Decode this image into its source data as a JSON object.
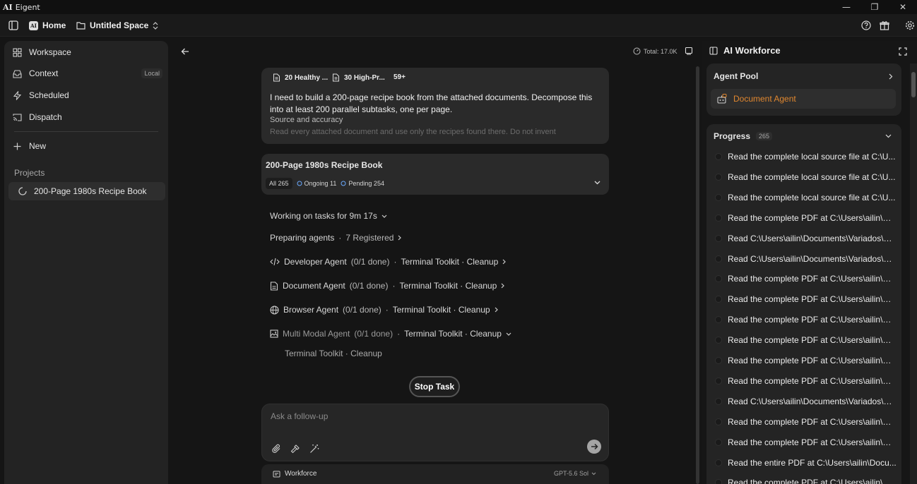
{
  "window": {
    "logo": "AI",
    "title": "Eigent",
    "minimize": "—",
    "restore": "❐",
    "close": "✕"
  },
  "topbar": {
    "home_label": "Home",
    "space_label": "Untitled Space",
    "logo_text": "AI"
  },
  "sidebar": {
    "items": [
      {
        "label": "Workspace",
        "icon": "grid-icon"
      },
      {
        "label": "Context",
        "icon": "inbox-icon",
        "badge": "Local"
      },
      {
        "label": "Scheduled",
        "icon": "bolt-icon"
      },
      {
        "label": "Dispatch",
        "icon": "cast-icon"
      }
    ],
    "new_label": "New",
    "projects_label": "Projects",
    "project_name": "200-Page 1980s Recipe Book"
  },
  "main": {
    "total_label": "Total: 17.0K",
    "message": {
      "attachments": [
        "20 Healthy ...",
        "30 High-Pr...",
        "59+"
      ],
      "text": "I need to build a 200-page recipe book from the attached documents. Decompose this into at least 200 parallel subtasks, one per page.",
      "subheading": "Source and accuracy",
      "faded": "Read every attached document and use only the recipes found there. Do not invent"
    },
    "task": {
      "title": "200-Page 1980s Recipe Book",
      "all": "All 265",
      "ongoing": "Ongoing 11",
      "pending": "Pending 254"
    },
    "working": "Working on tasks for 9m 17s",
    "preparing": "Preparing agents",
    "registered": "7 Registered",
    "agents": [
      {
        "name": "Developer Agent",
        "progress": "(0/1 done)",
        "tools": "Terminal Toolkit · Cleanup",
        "icon": "code-icon"
      },
      {
        "name": "Document Agent",
        "progress": "(0/1 done)",
        "tools": "Terminal Toolkit · Cleanup",
        "icon": "document-icon"
      },
      {
        "name": "Browser Agent",
        "progress": "(0/1 done)",
        "tools": "Terminal Toolkit · Cleanup",
        "icon": "globe-icon"
      },
      {
        "name": "Multi Modal Agent",
        "progress": "(0/1 done)",
        "tools": "Terminal Toolkit · Cleanup",
        "icon": "image-icon"
      }
    ],
    "expanded_tools": "Terminal Toolkit · Cleanup",
    "stop_label": "Stop Task",
    "input_placeholder": "Ask a follow-up",
    "workforce_label": "Workforce",
    "model_label": "GPT-5.6 Sol"
  },
  "right": {
    "title": "AI Workforce",
    "agent_pool_label": "Agent Pool",
    "agent_name": "Document Agent",
    "progress_label": "Progress",
    "progress_count": "265",
    "items": [
      "Read the complete local source file at C:\\U...",
      "Read the complete local source file at C:\\U...",
      "Read the complete local source file at C:\\U...",
      "Read the complete PDF at C:\\Users\\ailin\\Do...",
      "Read C:\\Users\\ailin\\Documents\\Variados\\Re...",
      "Read C:\\Users\\ailin\\Documents\\Variados\\Re...",
      "Read the complete PDF at C:\\Users\\ailin\\Do...",
      "Read the complete PDF at C:\\Users\\ailin\\Do...",
      "Read the complete PDF at C:\\Users\\ailin\\Do...",
      "Read the complete PDF at C:\\Users\\ailin\\Do...",
      "Read the complete PDF at C:\\Users\\ailin\\Do...",
      "Read the complete PDF at C:\\Users\\ailin\\Do...",
      "Read C:\\Users\\ailin\\Documents\\Variados\\Re...",
      "Read the complete PDF at C:\\Users\\ailin\\Do...",
      "Read the complete PDF at C:\\Users\\ailin\\Do...",
      "Read the entire PDF at C:\\Users\\ailin\\Docu...",
      "Read the complete PDF at C:\\Users\\ailin\\Do..."
    ]
  }
}
